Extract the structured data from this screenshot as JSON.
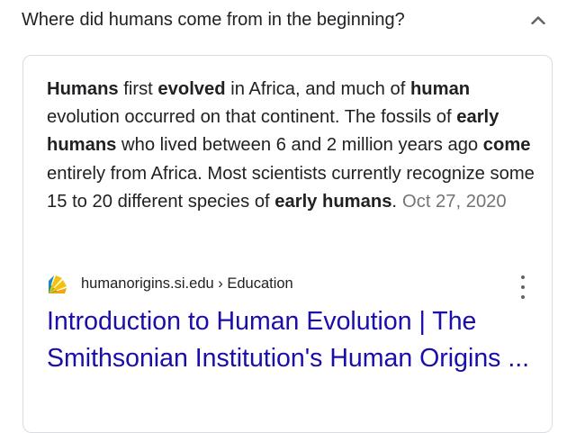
{
  "question": {
    "text": "Where did humans come from in the beginning?",
    "collapse_icon": "chevron-up-icon"
  },
  "answer": {
    "segments": [
      {
        "text": "Humans",
        "bold": true
      },
      {
        "text": " first ",
        "bold": false
      },
      {
        "text": "evolved",
        "bold": true
      },
      {
        "text": " in Africa, and much of ",
        "bold": false
      },
      {
        "text": "human",
        "bold": true
      },
      {
        "text": " evolution occurred on that continent. The fossils of ",
        "bold": false
      },
      {
        "text": "early humans",
        "bold": true
      },
      {
        "text": " who lived between 6 and 2 million years ago ",
        "bold": false
      },
      {
        "text": "come",
        "bold": true
      },
      {
        "text": " entirely from Africa. Most scientists currently recognize some 15 to 20 different species of ",
        "bold": false
      },
      {
        "text": "early humans",
        "bold": true
      },
      {
        "text": ".",
        "bold": false
      }
    ],
    "date": "Oct 27, 2020"
  },
  "source": {
    "favicon": "smithsonian-sunburst-icon",
    "domain": "humanorigins.si.edu",
    "separator": " › ",
    "category": "Education",
    "more_icon": "more-vert-icon"
  },
  "result": {
    "title": "Introduction to Human Evolution | The Smithsonian Institution's Human Origins ..."
  },
  "colors": {
    "link": "#1a0dab",
    "text": "#202124",
    "muted": "#70757a",
    "border": "#dadce0",
    "favicon_yellow": "#f4c20d",
    "favicon_blue": "#1e88c7",
    "favicon_green": "#2aa84a"
  }
}
